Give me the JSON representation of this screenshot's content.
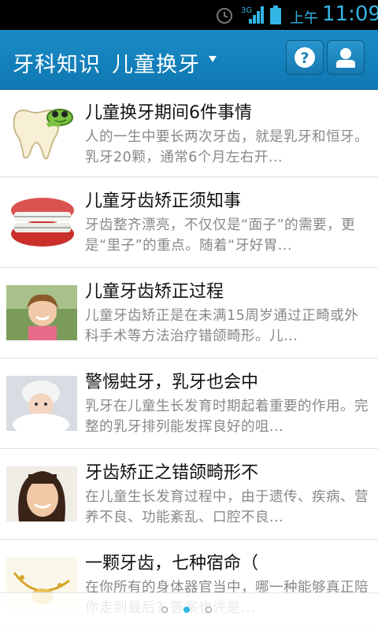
{
  "statusbar": {
    "ampm": "上午",
    "time": "11:09"
  },
  "appbar": {
    "title": "牙科知识",
    "subtitle": "儿童换牙",
    "dropdown_icon": "caret-down-icon",
    "help_icon": "question-icon",
    "profile_icon": "user-icon"
  },
  "articles": [
    {
      "title": "儿童换牙期间6件事情",
      "summary": "人的一生中要长两次牙齿，就是乳牙和恒牙。乳牙20颗，通常6个月左右开...",
      "thumb": "tooth-cartoon"
    },
    {
      "title": "儿童牙齿矫正须知事",
      "summary": "牙齿整齐漂亮，不仅仅是“面子”的需要，更是“里子”的重点。随着“牙好胃...",
      "thumb": "braces"
    },
    {
      "title": "儿童牙齿矫正过程",
      "summary": "儿童牙齿矫正是在未满15周岁通过正畸或外科手术等方法治疗错颌畸形。儿...",
      "thumb": "girl-photo"
    },
    {
      "title": "警惕蛀牙，乳牙也会中",
      "summary": "乳牙在儿童生长发育时期起着重要的作用。完整的乳牙排列能发挥良好的咀...",
      "thumb": "baby-photo"
    },
    {
      "title": "牙齿矫正之错颌畸形不",
      "summary": "在儿童生长发育过程中，由于遗传、疾病、营养不良、功能紊乱、口腔不良...",
      "thumb": "child-smile"
    },
    {
      "title": "一颗牙齿，七种宿命（",
      "summary": "在你所有的身体器官当中，哪一种能够真正陪你走到最后？答案也许是...",
      "thumb": "gold-item"
    }
  ],
  "pager": {
    "pages": 3,
    "active": 1
  }
}
